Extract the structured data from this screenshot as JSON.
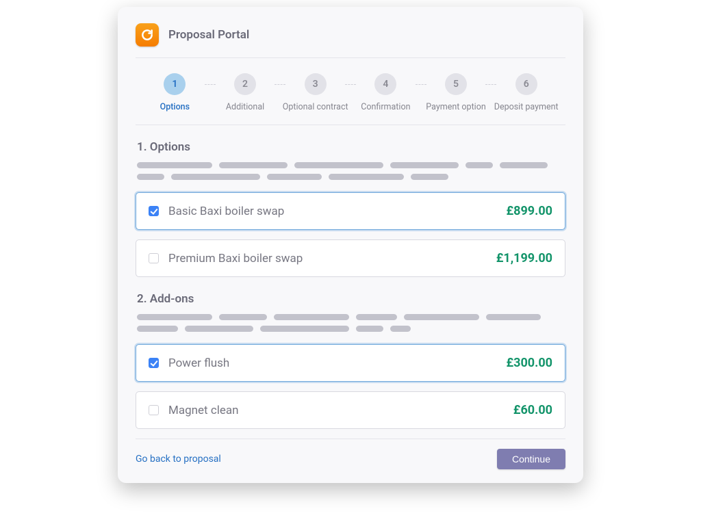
{
  "header": {
    "title": "Proposal Portal"
  },
  "steps": [
    {
      "num": "1",
      "label": "Options",
      "active": true
    },
    {
      "num": "2",
      "label": "Additional",
      "active": false
    },
    {
      "num": "3",
      "label": "Optional contract",
      "active": false
    },
    {
      "num": "4",
      "label": "Confirmation",
      "active": false
    },
    {
      "num": "5",
      "label": "Payment option",
      "active": false
    },
    {
      "num": "6",
      "label": "Deposit payment",
      "active": false
    }
  ],
  "sections": {
    "options": {
      "title": "1. Options",
      "items": [
        {
          "label": "Basic Baxi boiler swap",
          "price": "£899.00",
          "selected": true
        },
        {
          "label": "Premium Baxi boiler swap",
          "price": "£1,199.00",
          "selected": false
        }
      ]
    },
    "addons": {
      "title": "2. Add-ons",
      "items": [
        {
          "label": "Power flush",
          "price": "£300.00",
          "selected": true
        },
        {
          "label": "Magnet clean",
          "price": "£60.00",
          "selected": false
        }
      ]
    }
  },
  "footer": {
    "back_label": "Go back to proposal",
    "continue_label": "Continue"
  }
}
